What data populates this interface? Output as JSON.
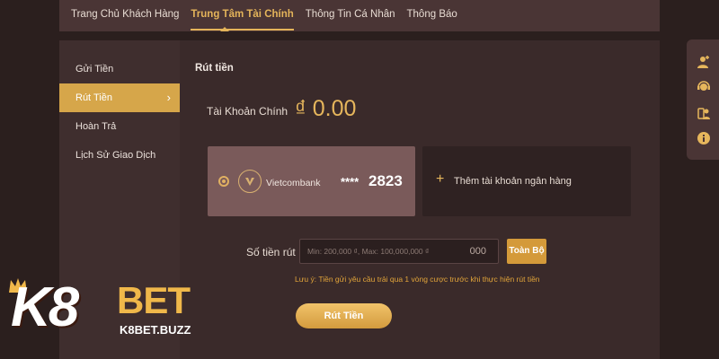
{
  "topnav": {
    "tabs": [
      {
        "label": "Trang Chủ Khách Hàng"
      },
      {
        "label": "Trung Tâm Tài Chính"
      },
      {
        "label": "Thông Tin Cá Nhân"
      },
      {
        "label": "Thông Báo"
      }
    ]
  },
  "sidebar": {
    "items": [
      {
        "label": "Gửi Tiền"
      },
      {
        "label": "Rút Tiền"
      },
      {
        "label": "Hoàn Trả"
      },
      {
        "label": "Lịch Sử Giao Dịch"
      }
    ],
    "chevron": "›"
  },
  "main": {
    "title": "Rút tiền",
    "account_label": "Tài Khoản Chính",
    "account_amount": "₫ 0.00",
    "bank": {
      "name": "Vietcombank",
      "masked": "****",
      "last_digits": "2823"
    },
    "add_bank": {
      "plus": "+",
      "label": "Thêm tài khoản ngân hàng"
    },
    "amount_label": "Số tiền rút",
    "amount_placeholder": "Min: 200,000 ₫, Max: 100,000,000 ₫",
    "amount_suffix": "000",
    "all_button": "Toàn Bộ",
    "note": "Lưu ý: Tiền gửi yêu cầu trải qua 1 vòng cược trước khi thực hiện rút tiền",
    "withdraw_button": "Rút Tiền"
  },
  "floatbar": {
    "icons": [
      "user-add-icon",
      "support-agent-icon",
      "user-key-icon",
      "info-icon"
    ]
  },
  "logo": {
    "brand_k8": "K8",
    "brand_bet": "BET",
    "domain": "K8BET.BUZZ"
  },
  "colors": {
    "accent": "#e6b65c",
    "sidebar_active": "#d6a64a",
    "button": "#d49a3a",
    "note": "#e1a43a"
  }
}
